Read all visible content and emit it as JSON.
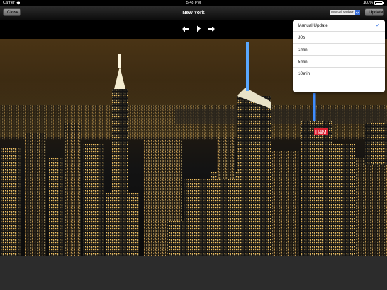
{
  "status_bar": {
    "carrier": "Carrier",
    "time": "5:48 PM",
    "battery_percent": "100%"
  },
  "nav_bar": {
    "title": "New York",
    "close_label": "Close",
    "update_label": "Update",
    "refresh_mode": "Manual Update"
  },
  "controls": {
    "prev_icon": "left-arrow-icon",
    "play_icon": "play-icon",
    "next_icon": "right-arrow-icon"
  },
  "popover": {
    "options": [
      {
        "label": "Manual Update",
        "selected": true
      },
      {
        "label": "30s",
        "selected": false
      },
      {
        "label": "1min",
        "selected": false
      },
      {
        "label": "5min",
        "selected": false
      },
      {
        "label": "10min",
        "selected": false
      }
    ],
    "check_glyph": "✓"
  },
  "colors": {
    "accent": "#2f6ee0",
    "nav_background": "#1a1a1a",
    "sky_top": "#4a3415"
  },
  "photo": {
    "subject": "city-skyline-night"
  }
}
